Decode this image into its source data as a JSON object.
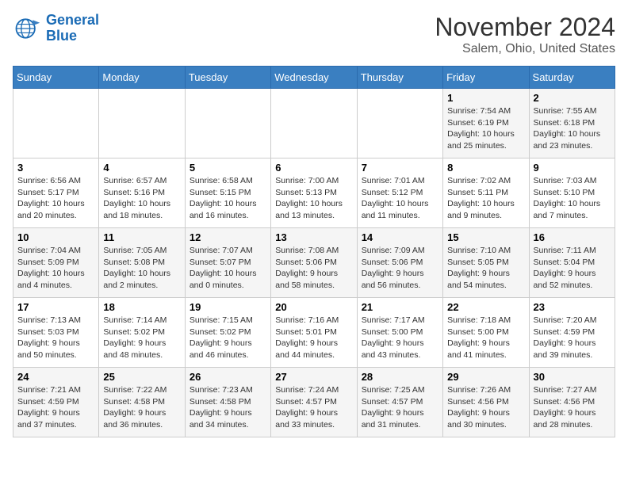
{
  "logo": {
    "line1": "General",
    "line2": "Blue"
  },
  "title": "November 2024",
  "location": "Salem, Ohio, United States",
  "days_of_week": [
    "Sunday",
    "Monday",
    "Tuesday",
    "Wednesday",
    "Thursday",
    "Friday",
    "Saturday"
  ],
  "weeks": [
    [
      {
        "day": "",
        "info": ""
      },
      {
        "day": "",
        "info": ""
      },
      {
        "day": "",
        "info": ""
      },
      {
        "day": "",
        "info": ""
      },
      {
        "day": "",
        "info": ""
      },
      {
        "day": "1",
        "info": "Sunrise: 7:54 AM\nSunset: 6:19 PM\nDaylight: 10 hours and 25 minutes."
      },
      {
        "day": "2",
        "info": "Sunrise: 7:55 AM\nSunset: 6:18 PM\nDaylight: 10 hours and 23 minutes."
      }
    ],
    [
      {
        "day": "3",
        "info": "Sunrise: 6:56 AM\nSunset: 5:17 PM\nDaylight: 10 hours and 20 minutes."
      },
      {
        "day": "4",
        "info": "Sunrise: 6:57 AM\nSunset: 5:16 PM\nDaylight: 10 hours and 18 minutes."
      },
      {
        "day": "5",
        "info": "Sunrise: 6:58 AM\nSunset: 5:15 PM\nDaylight: 10 hours and 16 minutes."
      },
      {
        "day": "6",
        "info": "Sunrise: 7:00 AM\nSunset: 5:13 PM\nDaylight: 10 hours and 13 minutes."
      },
      {
        "day": "7",
        "info": "Sunrise: 7:01 AM\nSunset: 5:12 PM\nDaylight: 10 hours and 11 minutes."
      },
      {
        "day": "8",
        "info": "Sunrise: 7:02 AM\nSunset: 5:11 PM\nDaylight: 10 hours and 9 minutes."
      },
      {
        "day": "9",
        "info": "Sunrise: 7:03 AM\nSunset: 5:10 PM\nDaylight: 10 hours and 7 minutes."
      }
    ],
    [
      {
        "day": "10",
        "info": "Sunrise: 7:04 AM\nSunset: 5:09 PM\nDaylight: 10 hours and 4 minutes."
      },
      {
        "day": "11",
        "info": "Sunrise: 7:05 AM\nSunset: 5:08 PM\nDaylight: 10 hours and 2 minutes."
      },
      {
        "day": "12",
        "info": "Sunrise: 7:07 AM\nSunset: 5:07 PM\nDaylight: 10 hours and 0 minutes."
      },
      {
        "day": "13",
        "info": "Sunrise: 7:08 AM\nSunset: 5:06 PM\nDaylight: 9 hours and 58 minutes."
      },
      {
        "day": "14",
        "info": "Sunrise: 7:09 AM\nSunset: 5:06 PM\nDaylight: 9 hours and 56 minutes."
      },
      {
        "day": "15",
        "info": "Sunrise: 7:10 AM\nSunset: 5:05 PM\nDaylight: 9 hours and 54 minutes."
      },
      {
        "day": "16",
        "info": "Sunrise: 7:11 AM\nSunset: 5:04 PM\nDaylight: 9 hours and 52 minutes."
      }
    ],
    [
      {
        "day": "17",
        "info": "Sunrise: 7:13 AM\nSunset: 5:03 PM\nDaylight: 9 hours and 50 minutes."
      },
      {
        "day": "18",
        "info": "Sunrise: 7:14 AM\nSunset: 5:02 PM\nDaylight: 9 hours and 48 minutes."
      },
      {
        "day": "19",
        "info": "Sunrise: 7:15 AM\nSunset: 5:02 PM\nDaylight: 9 hours and 46 minutes."
      },
      {
        "day": "20",
        "info": "Sunrise: 7:16 AM\nSunset: 5:01 PM\nDaylight: 9 hours and 44 minutes."
      },
      {
        "day": "21",
        "info": "Sunrise: 7:17 AM\nSunset: 5:00 PM\nDaylight: 9 hours and 43 minutes."
      },
      {
        "day": "22",
        "info": "Sunrise: 7:18 AM\nSunset: 5:00 PM\nDaylight: 9 hours and 41 minutes."
      },
      {
        "day": "23",
        "info": "Sunrise: 7:20 AM\nSunset: 4:59 PM\nDaylight: 9 hours and 39 minutes."
      }
    ],
    [
      {
        "day": "24",
        "info": "Sunrise: 7:21 AM\nSunset: 4:59 PM\nDaylight: 9 hours and 37 minutes."
      },
      {
        "day": "25",
        "info": "Sunrise: 7:22 AM\nSunset: 4:58 PM\nDaylight: 9 hours and 36 minutes."
      },
      {
        "day": "26",
        "info": "Sunrise: 7:23 AM\nSunset: 4:58 PM\nDaylight: 9 hours and 34 minutes."
      },
      {
        "day": "27",
        "info": "Sunrise: 7:24 AM\nSunset: 4:57 PM\nDaylight: 9 hours and 33 minutes."
      },
      {
        "day": "28",
        "info": "Sunrise: 7:25 AM\nSunset: 4:57 PM\nDaylight: 9 hours and 31 minutes."
      },
      {
        "day": "29",
        "info": "Sunrise: 7:26 AM\nSunset: 4:56 PM\nDaylight: 9 hours and 30 minutes."
      },
      {
        "day": "30",
        "info": "Sunrise: 7:27 AM\nSunset: 4:56 PM\nDaylight: 9 hours and 28 minutes."
      }
    ]
  ]
}
